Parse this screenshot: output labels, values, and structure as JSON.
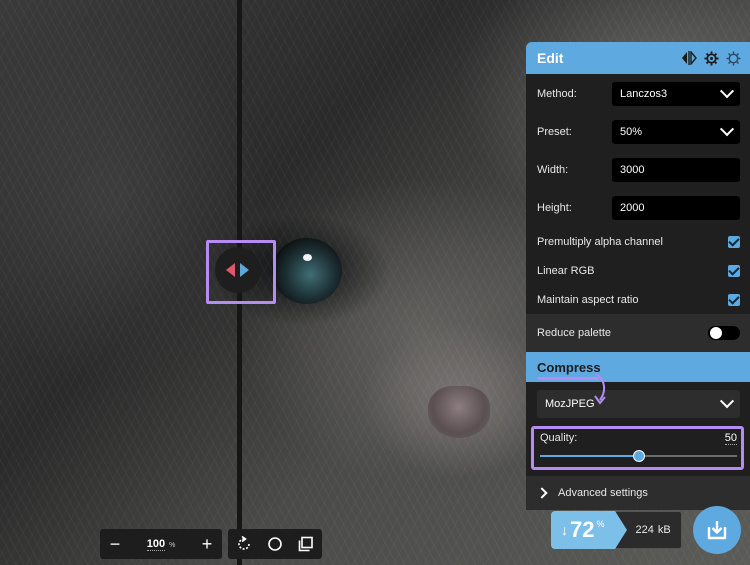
{
  "viewer": {
    "image_alt": "close-up of a grey kitten's face"
  },
  "edit": {
    "title": "Edit",
    "method": {
      "label": "Method:",
      "value": "Lanczos3"
    },
    "preset": {
      "label": "Preset:",
      "value": "50%"
    },
    "width": {
      "label": "Width:",
      "value": "3000"
    },
    "height": {
      "label": "Height:",
      "value": "2000"
    },
    "premultiply": {
      "label": "Premultiply alpha channel",
      "checked": true
    },
    "linear_rgb": {
      "label": "Linear RGB",
      "checked": true
    },
    "aspect": {
      "label": "Maintain aspect ratio",
      "checked": true
    },
    "reduce_palette": {
      "label": "Reduce palette",
      "on": false
    }
  },
  "compress": {
    "title": "Compress",
    "encoder": "MozJPEG",
    "quality_label": "Quality:",
    "quality_value": "50",
    "quality_fraction": 0.5,
    "advanced_label": "Advanced settings"
  },
  "result": {
    "arrow": "↓",
    "percent": "72",
    "percent_symbol": "%",
    "size_value": "224",
    "size_unit": "kB"
  },
  "zoom": {
    "minus": "−",
    "value": "100",
    "unit": "%",
    "plus": "+"
  },
  "colors": {
    "accent": "#5da9e0",
    "highlight": "#b58cf0",
    "panel_bg": "#1f1f1f"
  }
}
